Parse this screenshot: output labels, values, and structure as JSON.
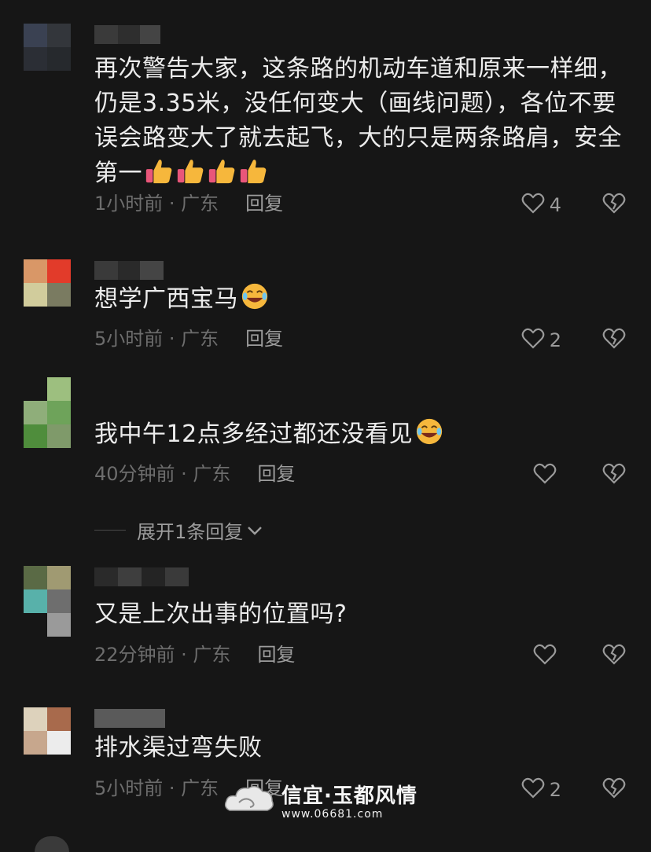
{
  "comments": [
    {
      "text": "再次警告大家，这条路的机动车道和原来一样细，仍是3.35米，没任何变大（画线问题），各位不要误会路变大了就去起飞，大的只是两条路肩，安全第一",
      "emojis": [
        "thumbs-up-icon",
        "thumbs-up-icon",
        "thumbs-up-icon",
        "thumbs-up-icon"
      ],
      "time": "1小时前 · 广东",
      "reply": "回复",
      "likes": "4",
      "avatar_colors": [
        "#3a4152",
        "#33363b",
        "#2b2e35",
        "#26292d"
      ]
    },
    {
      "text": "想学广西宝马",
      "emojis": [
        "laughing-emoji-icon"
      ],
      "time": "5小时前 · 广东",
      "reply": "回复",
      "likes": "2",
      "avatar_colors": [
        "#d99767",
        "#e23b2a",
        "#d1cc9c",
        "#7a7b61"
      ]
    },
    {
      "text": "我中午12点多经过都还没看见",
      "emojis": [
        "laughing-emoji-icon"
      ],
      "time": "40分钟前 · 广东",
      "reply": "回复",
      "likes": "",
      "avatar_colors": [
        "#9dbf7f",
        "#6ea35a",
        "#4f8d3c",
        "#7f9a6a"
      ]
    },
    {
      "text": "又是上次出事的位置吗?",
      "emojis": [],
      "time": "22分钟前 · 广东",
      "reply": "回复",
      "likes": "",
      "avatar_colors": [
        "#5a6a45",
        "#a09a72",
        "#58b1aa",
        "#6e6e6e"
      ]
    },
    {
      "text": "排水渠过弯失败",
      "emojis": [],
      "time": "5小时前 · 广东",
      "reply": "回复",
      "likes": "2",
      "avatar_colors": [
        "#ddd2bc",
        "#a86a4c",
        "#c7a78d",
        "#ececec"
      ]
    }
  ],
  "expand_replies": "展开1条回复",
  "watermark": {
    "title": "信宜·玉都风情",
    "url": "www.06681.com"
  },
  "colors": {
    "background": "#161616",
    "text": "#ececec",
    "meta": "#6d6d6d"
  }
}
